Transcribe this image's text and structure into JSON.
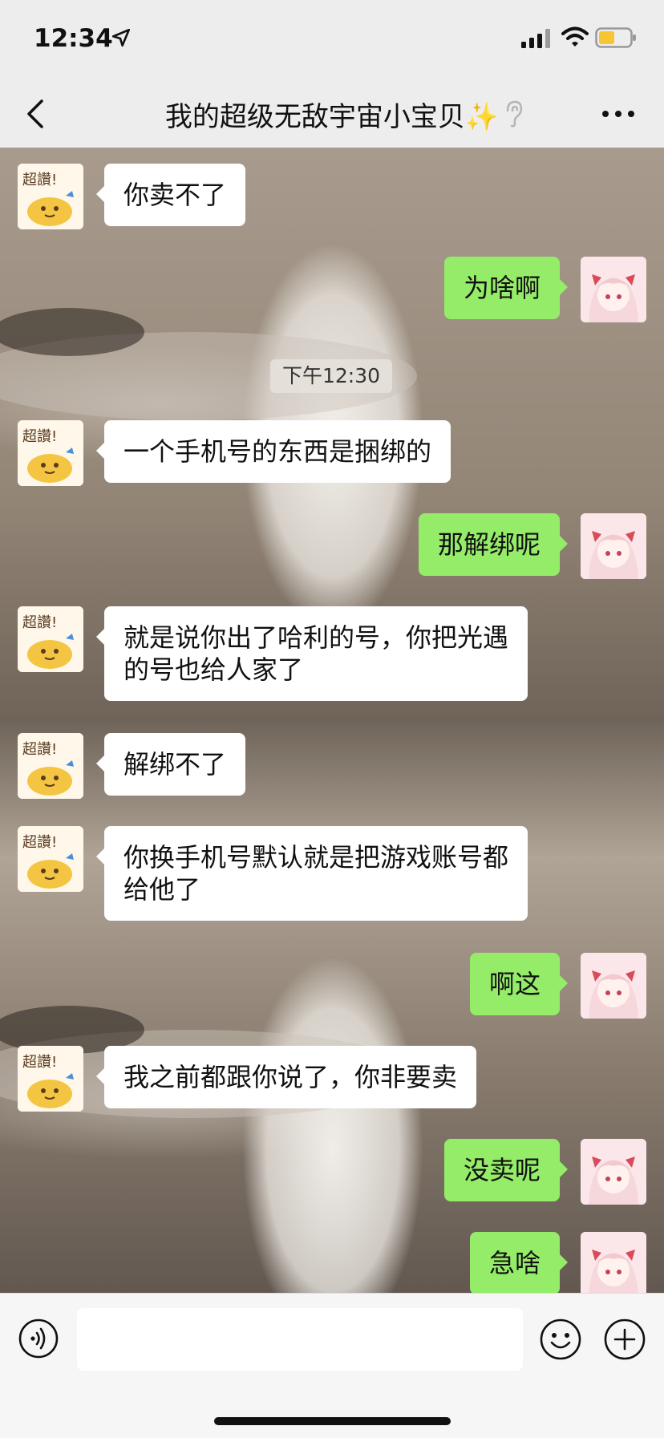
{
  "status_bar": {
    "time": "12:34"
  },
  "header": {
    "title": "我的超级无敌宇宙小宝贝✨"
  },
  "chat": {
    "timestamp": "下午12:30",
    "messages": [
      {
        "side": "left",
        "text": "你卖不了"
      },
      {
        "side": "right",
        "text": "为啥啊"
      },
      {
        "side": "left",
        "text": "一个手机号的东西是捆绑的"
      },
      {
        "side": "right",
        "text": "那解绑呢"
      },
      {
        "side": "left",
        "text": "就是说你出了哈利的号，你把光遇\n的号也给人家了"
      },
      {
        "side": "left",
        "text": "解绑不了"
      },
      {
        "side": "left",
        "text": "你换手机号默认就是把游戏账号都\n给他了"
      },
      {
        "side": "right",
        "text": "啊这"
      },
      {
        "side": "left",
        "text": "我之前都跟你说了，你非要卖"
      },
      {
        "side": "right",
        "text": "没卖呢"
      },
      {
        "side": "right",
        "text": "急啥"
      }
    ]
  },
  "input_bar": {
    "placeholder": ""
  },
  "colors": {
    "sent_bubble": "#95ec69",
    "received_bubble": "#ffffff",
    "chrome": "#ededed"
  },
  "icons": [
    "location-arrow-icon",
    "signal-icon",
    "wifi-icon",
    "battery-icon",
    "back-chevron-icon",
    "ear-icon",
    "more-icon",
    "voice-icon",
    "emoji-icon",
    "plus-icon"
  ]
}
